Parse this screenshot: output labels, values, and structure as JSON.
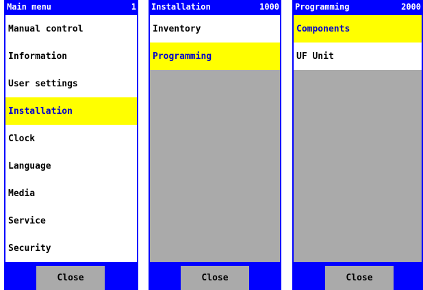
{
  "colors": {
    "frame": "#0000ff",
    "header_text": "#ffffff",
    "item_bg": "#ffffff",
    "item_text": "#000000",
    "selected_bg": "#ffff00",
    "selected_text": "#0000cc",
    "empty_bg": "#aaaaaa",
    "button_bg": "#aaaaaa"
  },
  "panels": [
    {
      "title": "Main menu",
      "code": "1",
      "items": [
        {
          "label": "Manual control",
          "selected": false
        },
        {
          "label": "Information",
          "selected": false
        },
        {
          "label": "User settings",
          "selected": false
        },
        {
          "label": "Installation",
          "selected": true
        },
        {
          "label": "Clock",
          "selected": false
        },
        {
          "label": "Language",
          "selected": false
        },
        {
          "label": "Media",
          "selected": false
        },
        {
          "label": "Service",
          "selected": false
        },
        {
          "label": "Security",
          "selected": false
        }
      ],
      "close_label": "Close"
    },
    {
      "title": "Installation",
      "code": "1000",
      "items": [
        {
          "label": "Inventory",
          "selected": false
        },
        {
          "label": "Programming",
          "selected": true
        }
      ],
      "close_label": "Close"
    },
    {
      "title": "Programming",
      "code": "2000",
      "items": [
        {
          "label": "Components",
          "selected": true
        },
        {
          "label": "UF Unit",
          "selected": false
        }
      ],
      "close_label": "Close"
    }
  ]
}
